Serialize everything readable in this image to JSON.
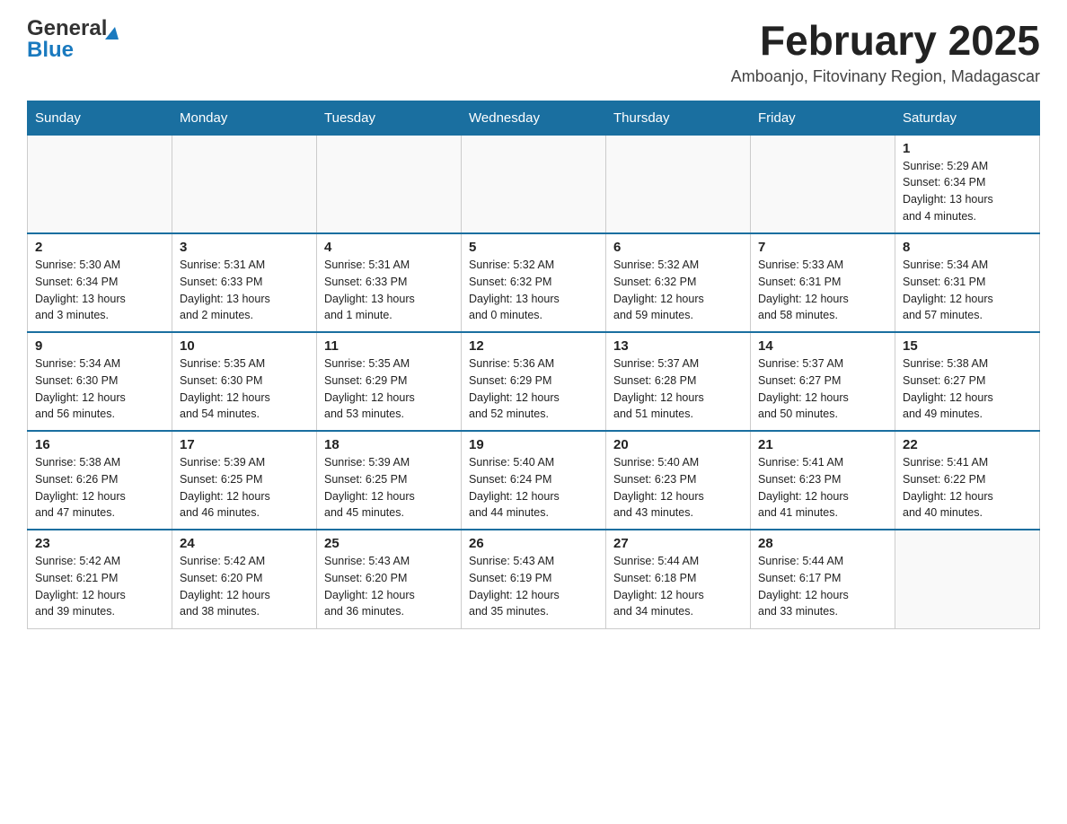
{
  "header": {
    "logo_general": "General",
    "logo_blue": "Blue",
    "month_title": "February 2025",
    "location": "Amboanjo, Fitovinany Region, Madagascar"
  },
  "weekdays": [
    "Sunday",
    "Monday",
    "Tuesday",
    "Wednesday",
    "Thursday",
    "Friday",
    "Saturday"
  ],
  "weeks": [
    [
      {
        "day": "",
        "info": ""
      },
      {
        "day": "",
        "info": ""
      },
      {
        "day": "",
        "info": ""
      },
      {
        "day": "",
        "info": ""
      },
      {
        "day": "",
        "info": ""
      },
      {
        "day": "",
        "info": ""
      },
      {
        "day": "1",
        "info": "Sunrise: 5:29 AM\nSunset: 6:34 PM\nDaylight: 13 hours\nand 4 minutes."
      }
    ],
    [
      {
        "day": "2",
        "info": "Sunrise: 5:30 AM\nSunset: 6:34 PM\nDaylight: 13 hours\nand 3 minutes."
      },
      {
        "day": "3",
        "info": "Sunrise: 5:31 AM\nSunset: 6:33 PM\nDaylight: 13 hours\nand 2 minutes."
      },
      {
        "day": "4",
        "info": "Sunrise: 5:31 AM\nSunset: 6:33 PM\nDaylight: 13 hours\nand 1 minute."
      },
      {
        "day": "5",
        "info": "Sunrise: 5:32 AM\nSunset: 6:32 PM\nDaylight: 13 hours\nand 0 minutes."
      },
      {
        "day": "6",
        "info": "Sunrise: 5:32 AM\nSunset: 6:32 PM\nDaylight: 12 hours\nand 59 minutes."
      },
      {
        "day": "7",
        "info": "Sunrise: 5:33 AM\nSunset: 6:31 PM\nDaylight: 12 hours\nand 58 minutes."
      },
      {
        "day": "8",
        "info": "Sunrise: 5:34 AM\nSunset: 6:31 PM\nDaylight: 12 hours\nand 57 minutes."
      }
    ],
    [
      {
        "day": "9",
        "info": "Sunrise: 5:34 AM\nSunset: 6:30 PM\nDaylight: 12 hours\nand 56 minutes."
      },
      {
        "day": "10",
        "info": "Sunrise: 5:35 AM\nSunset: 6:30 PM\nDaylight: 12 hours\nand 54 minutes."
      },
      {
        "day": "11",
        "info": "Sunrise: 5:35 AM\nSunset: 6:29 PM\nDaylight: 12 hours\nand 53 minutes."
      },
      {
        "day": "12",
        "info": "Sunrise: 5:36 AM\nSunset: 6:29 PM\nDaylight: 12 hours\nand 52 minutes."
      },
      {
        "day": "13",
        "info": "Sunrise: 5:37 AM\nSunset: 6:28 PM\nDaylight: 12 hours\nand 51 minutes."
      },
      {
        "day": "14",
        "info": "Sunrise: 5:37 AM\nSunset: 6:27 PM\nDaylight: 12 hours\nand 50 minutes."
      },
      {
        "day": "15",
        "info": "Sunrise: 5:38 AM\nSunset: 6:27 PM\nDaylight: 12 hours\nand 49 minutes."
      }
    ],
    [
      {
        "day": "16",
        "info": "Sunrise: 5:38 AM\nSunset: 6:26 PM\nDaylight: 12 hours\nand 47 minutes."
      },
      {
        "day": "17",
        "info": "Sunrise: 5:39 AM\nSunset: 6:25 PM\nDaylight: 12 hours\nand 46 minutes."
      },
      {
        "day": "18",
        "info": "Sunrise: 5:39 AM\nSunset: 6:25 PM\nDaylight: 12 hours\nand 45 minutes."
      },
      {
        "day": "19",
        "info": "Sunrise: 5:40 AM\nSunset: 6:24 PM\nDaylight: 12 hours\nand 44 minutes."
      },
      {
        "day": "20",
        "info": "Sunrise: 5:40 AM\nSunset: 6:23 PM\nDaylight: 12 hours\nand 43 minutes."
      },
      {
        "day": "21",
        "info": "Sunrise: 5:41 AM\nSunset: 6:23 PM\nDaylight: 12 hours\nand 41 minutes."
      },
      {
        "day": "22",
        "info": "Sunrise: 5:41 AM\nSunset: 6:22 PM\nDaylight: 12 hours\nand 40 minutes."
      }
    ],
    [
      {
        "day": "23",
        "info": "Sunrise: 5:42 AM\nSunset: 6:21 PM\nDaylight: 12 hours\nand 39 minutes."
      },
      {
        "day": "24",
        "info": "Sunrise: 5:42 AM\nSunset: 6:20 PM\nDaylight: 12 hours\nand 38 minutes."
      },
      {
        "day": "25",
        "info": "Sunrise: 5:43 AM\nSunset: 6:20 PM\nDaylight: 12 hours\nand 36 minutes."
      },
      {
        "day": "26",
        "info": "Sunrise: 5:43 AM\nSunset: 6:19 PM\nDaylight: 12 hours\nand 35 minutes."
      },
      {
        "day": "27",
        "info": "Sunrise: 5:44 AM\nSunset: 6:18 PM\nDaylight: 12 hours\nand 34 minutes."
      },
      {
        "day": "28",
        "info": "Sunrise: 5:44 AM\nSunset: 6:17 PM\nDaylight: 12 hours\nand 33 minutes."
      },
      {
        "day": "",
        "info": ""
      }
    ]
  ]
}
